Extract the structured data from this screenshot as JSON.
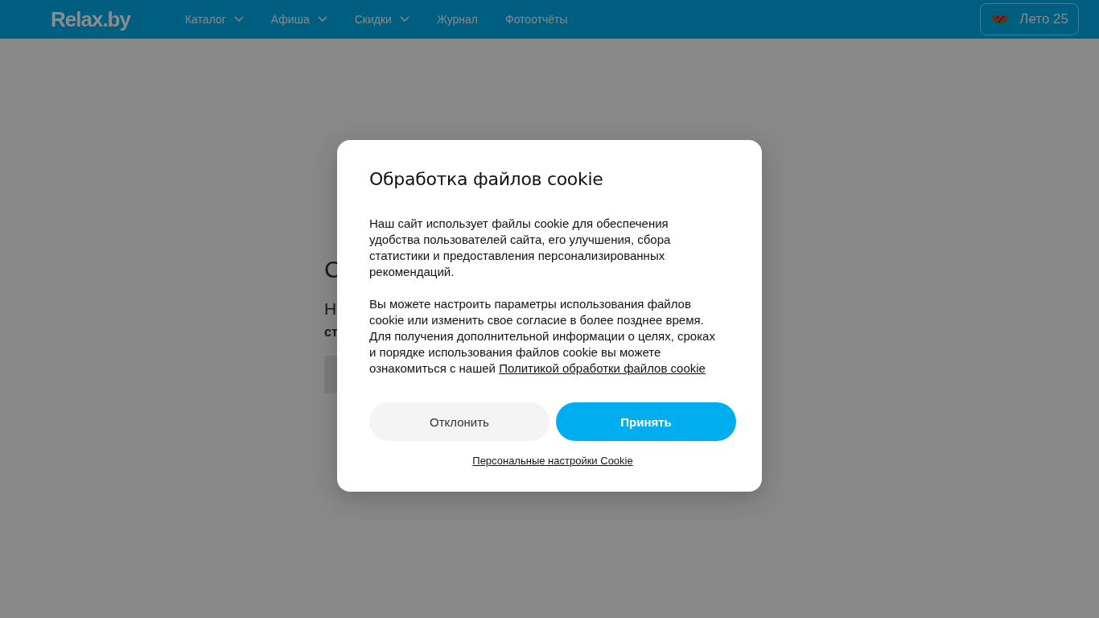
{
  "header": {
    "logo": "Relax.by",
    "nav": [
      {
        "label": "Каталог",
        "dropdown": true
      },
      {
        "label": "Афиша",
        "dropdown": true
      },
      {
        "label": "Скидки",
        "dropdown": true
      },
      {
        "label": "Журнал",
        "dropdown": false
      },
      {
        "label": "Фотоотчёты",
        "dropdown": false
      }
    ],
    "promo": "Лето 25"
  },
  "page": {
    "heading": "С",
    "text": "Н",
    "subtext": "ст"
  },
  "cookie_dialog": {
    "title": "Обработка файлов cookie",
    "paragraphs": [
      "Наш сайт использует файлы cookie для обеспечения удобства пользователей сайта, его улучшения, сбора статистики и предоставления персонализированных рекомендаций.",
      "Вы можете настроить параметры использования файлов cookie или изменить свое согласие в более позднее время. Для получения дополнительной информации о целях, сроках и порядке использования файлов cookie вы можете ознакомиться с нашей"
    ],
    "policy_link": "Политикой обработки файлов cookie",
    "buttons": [
      {
        "label": "Отклонить",
        "kind": "secondary"
      },
      {
        "label": "Принять",
        "kind": "primary"
      }
    ],
    "settings_link": "Персональные настройки Cookie"
  }
}
